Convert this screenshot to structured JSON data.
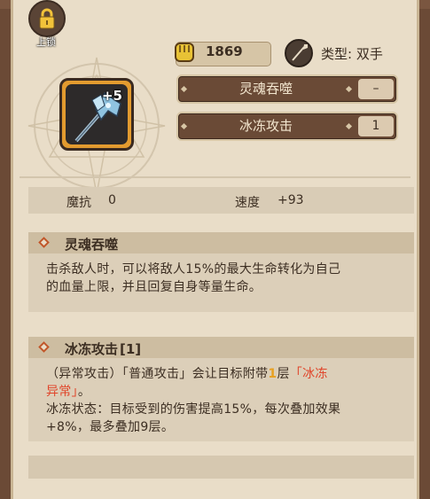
{
  "lock": {
    "label": "上锁",
    "icon": "lock-icon"
  },
  "weapon": {
    "icon": "ice-axe-icon",
    "enhance": "+5",
    "frame_color": "#e39b2f"
  },
  "header": {
    "power_value": "1869",
    "power_icon": "fist-icon",
    "type_icon": "spear-icon",
    "type_text": "类型: 双手"
  },
  "skills": [
    {
      "name": "灵魂吞噬",
      "level": "–"
    },
    {
      "name": "冰冻攻击",
      "level": "1"
    }
  ],
  "stats": [
    {
      "label": "魔抗",
      "value": "0"
    },
    {
      "label": "速度",
      "value": "+93"
    }
  ],
  "descriptions": [
    {
      "title": "灵魂吞噬",
      "lines": [
        "击杀敌人时，可以将敌人15%的最大生命转化为自己",
        "的血量上限，并且回复自身等量生命。"
      ]
    },
    {
      "title": "冰冻攻击",
      "title_level": "[1]",
      "line1_a": "（异常攻击）「普通攻击」会让目标附带",
      "line1_num": "1",
      "line1_b": "层",
      "line1_red": "「冰冻",
      "line2_red": "异常」",
      "line2_b": "。",
      "line3": "冰冻状态：目标受到的伤害提高15%，每次叠加效果",
      "line4": "+8%，最多叠加9层。"
    }
  ],
  "colors": {
    "accent_red": "#e0452a",
    "panel_bg": "#e9ddc8",
    "button_brown": "#6a4a36"
  }
}
